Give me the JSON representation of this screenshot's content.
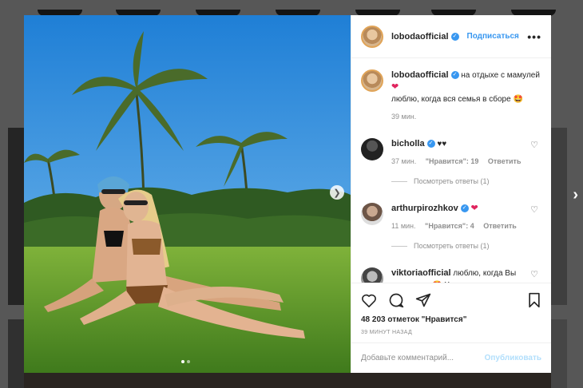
{
  "post": {
    "author": "lobodaofficial",
    "follow_label": "Подписаться",
    "more_label": "•••",
    "verified_mark": "✓",
    "caption_part1": "на отдыхе с мамулей",
    "caption_heart": "❤",
    "caption_part2": "люблю, когда вся семья в сборе",
    "caption_emoji": "🤩",
    "caption_time": "39 мин."
  },
  "comments": [
    {
      "user": "bicholla",
      "text": "♥♥",
      "time": "37 мин.",
      "likes": "\"Нравится\": 19",
      "reply": "Ответить",
      "view_replies": "Посмотреть ответы (1)"
    },
    {
      "user": "arthurpirozhkov",
      "text": "❤",
      "time": "11 мин.",
      "likes": "\"Нравится\": 4",
      "reply": "Ответить",
      "view_replies": "Посмотреть ответы (1)"
    },
    {
      "user": "viktoriaofficial",
      "text": "люблю, когда Вы отдыхаете 🤩 Хорошего отдыха"
    }
  ],
  "actions": {
    "likes_count": "48 203 отметок \"Нравится\"",
    "posted_time": "39 МИНУТ НАЗАД",
    "comment_placeholder": "Добавьте комментарий...",
    "publish_label": "Опубликовать"
  },
  "icons": [
    "heart-icon",
    "comment-icon",
    "share-icon",
    "bookmark-icon",
    "chevron-right-icon",
    "like-small-icon"
  ],
  "carousel": {
    "total_slides": 2,
    "active_slide": 1
  },
  "colors": {
    "accent": "#3897f0",
    "heart": "#e0245e",
    "overlay": "rgba(0,0,0,0.65)"
  }
}
